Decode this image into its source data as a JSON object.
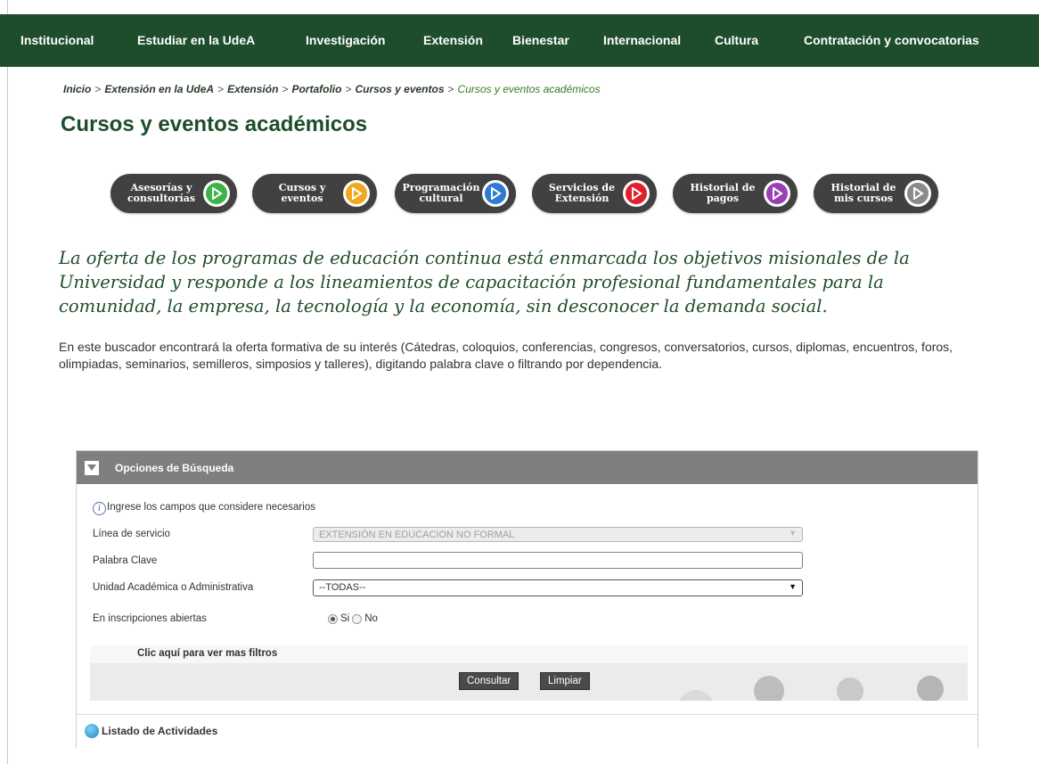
{
  "nav": {
    "items": [
      "Institucional",
      "Estudiar en la UdeA",
      "Investigación",
      "Extensión",
      "Bienestar",
      "Internacional",
      "Cultura",
      "Contratación y convocatorias"
    ]
  },
  "breadcrumb": {
    "items": [
      "Inicio",
      "Extensión en la UdeA",
      "Extensión",
      "Portafolio",
      "Cursos y eventos"
    ],
    "current": "Cursos y eventos académicos",
    "separator": ">"
  },
  "page": {
    "title": "Cursos y eventos académicos",
    "lead": "La oferta de los programas de educación continua está enmarcada los objetivos misionales de la Universidad y responde a los lineamientos de capacitación profesional fundamentales para la comunidad, la empresa, la tecnología y la economía, sin desconocer la demanda social.",
    "description": "En este buscador encontrará la oferta formativa de su interés (Cátedras, coloquios, conferencias, congresos, conversatorios, cursos, diplomas, encuentros, foros, olimpiadas, seminarios, semilleros, simposios y talleres), digitando palabra clave o filtrando por dependencia."
  },
  "pills": [
    {
      "line1": "Asesorías y",
      "line2": "consultorías",
      "color": "#3db34a"
    },
    {
      "line1": "Cursos y",
      "line2": "eventos",
      "color": "#f0a81e"
    },
    {
      "line1": "Programación",
      "line2": "cultural",
      "color": "#2f7bd1"
    },
    {
      "line1": "Servicios de",
      "line2": "Extensión",
      "color": "#e0202a"
    },
    {
      "line1": "Historial de",
      "line2": "pagos",
      "color": "#9b3fb5"
    },
    {
      "line1": "Historial de",
      "line2": "mis cursos",
      "color": "#8a8a8a"
    }
  ],
  "search": {
    "header": "Opciones de Búsqueda",
    "hint": "Ingrese los campos que considere necesarios",
    "service_line_label": "Línea de servicio",
    "service_line_value": "EXTENSIÓN EN EDUCACION NO FORMAL",
    "keyword_label": "Palabra Clave",
    "keyword_value": "",
    "unit_label": "Unidad Académica o Administrativa",
    "unit_value": "--TODAS--",
    "open_label": "En inscripciones abiertas",
    "yes_label": "Si",
    "no_label": "No",
    "open_selected": "Si",
    "more_filters": "Clic aquí para ver mas filtros",
    "consult_button": "Consultar",
    "clear_button": "Limpiar"
  },
  "list": {
    "header": "Listado de Actividades"
  },
  "colors": {
    "nav_bg": "#1e4d2b",
    "title": "#1e4d2b",
    "panel_header": "#7f7f7f"
  }
}
